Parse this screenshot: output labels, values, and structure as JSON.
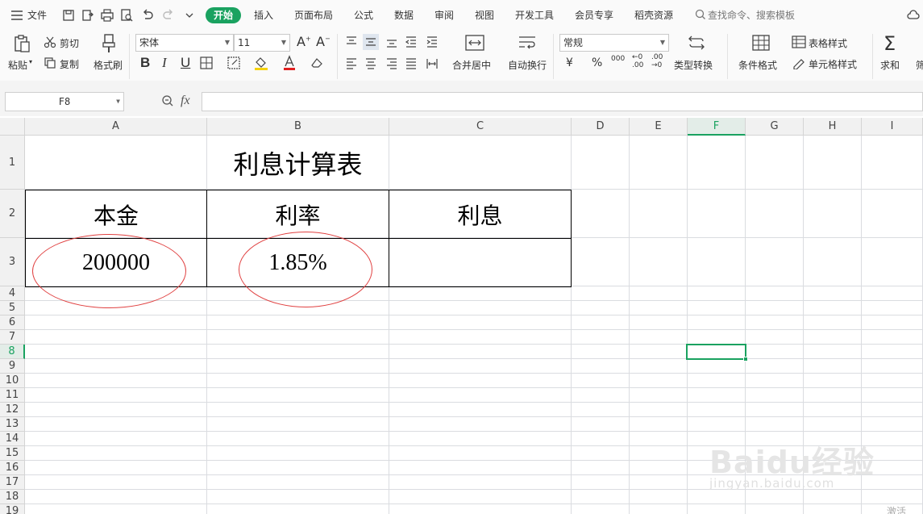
{
  "menu": {
    "file": "文件",
    "tabs": [
      "开始",
      "插入",
      "页面布局",
      "公式",
      "数据",
      "审阅",
      "视图",
      "开发工具",
      "会员专享",
      "稻壳资源"
    ],
    "search_placeholder": "查找命令、搜索模板"
  },
  "ribbon": {
    "paste": "粘贴",
    "cut": "剪切",
    "copy": "复制",
    "format_painter": "格式刷",
    "font_name": "宋体",
    "font_size": "11",
    "bold": "B",
    "italic": "I",
    "underline": "U",
    "merge_center": "合并居中",
    "wrap_text": "自动换行",
    "number_format": "常规",
    "currency": "¥",
    "percent": "%",
    "thousands": "000",
    "type_convert": "类型转换",
    "conditional_format": "条件格式",
    "table_style": "表格样式",
    "cell_style": "单元格样式",
    "sum": "求和",
    "filter": "筛"
  },
  "formula_bar": {
    "name_box": "F8",
    "fx": "fx",
    "formula": ""
  },
  "columns": [
    "A",
    "B",
    "C",
    "D",
    "E",
    "F",
    "G",
    "H",
    "I"
  ],
  "rows": [
    "1",
    "2",
    "3",
    "4",
    "5",
    "6",
    "7",
    "8",
    "9",
    "10",
    "11",
    "12",
    "13",
    "14",
    "15",
    "16",
    "17",
    "18",
    "19"
  ],
  "sheet": {
    "title": "利息计算表",
    "header_principal": "本金",
    "header_rate": "利率",
    "header_interest": "利息",
    "principal": "200000",
    "rate": "1.85%",
    "interest": ""
  },
  "watermark": {
    "brand": "Baidu经验",
    "url": "jingyan.baidu.com",
    "tail": "激活"
  },
  "colors": {
    "accent": "#1aa260",
    "annotation": "#e04040"
  }
}
